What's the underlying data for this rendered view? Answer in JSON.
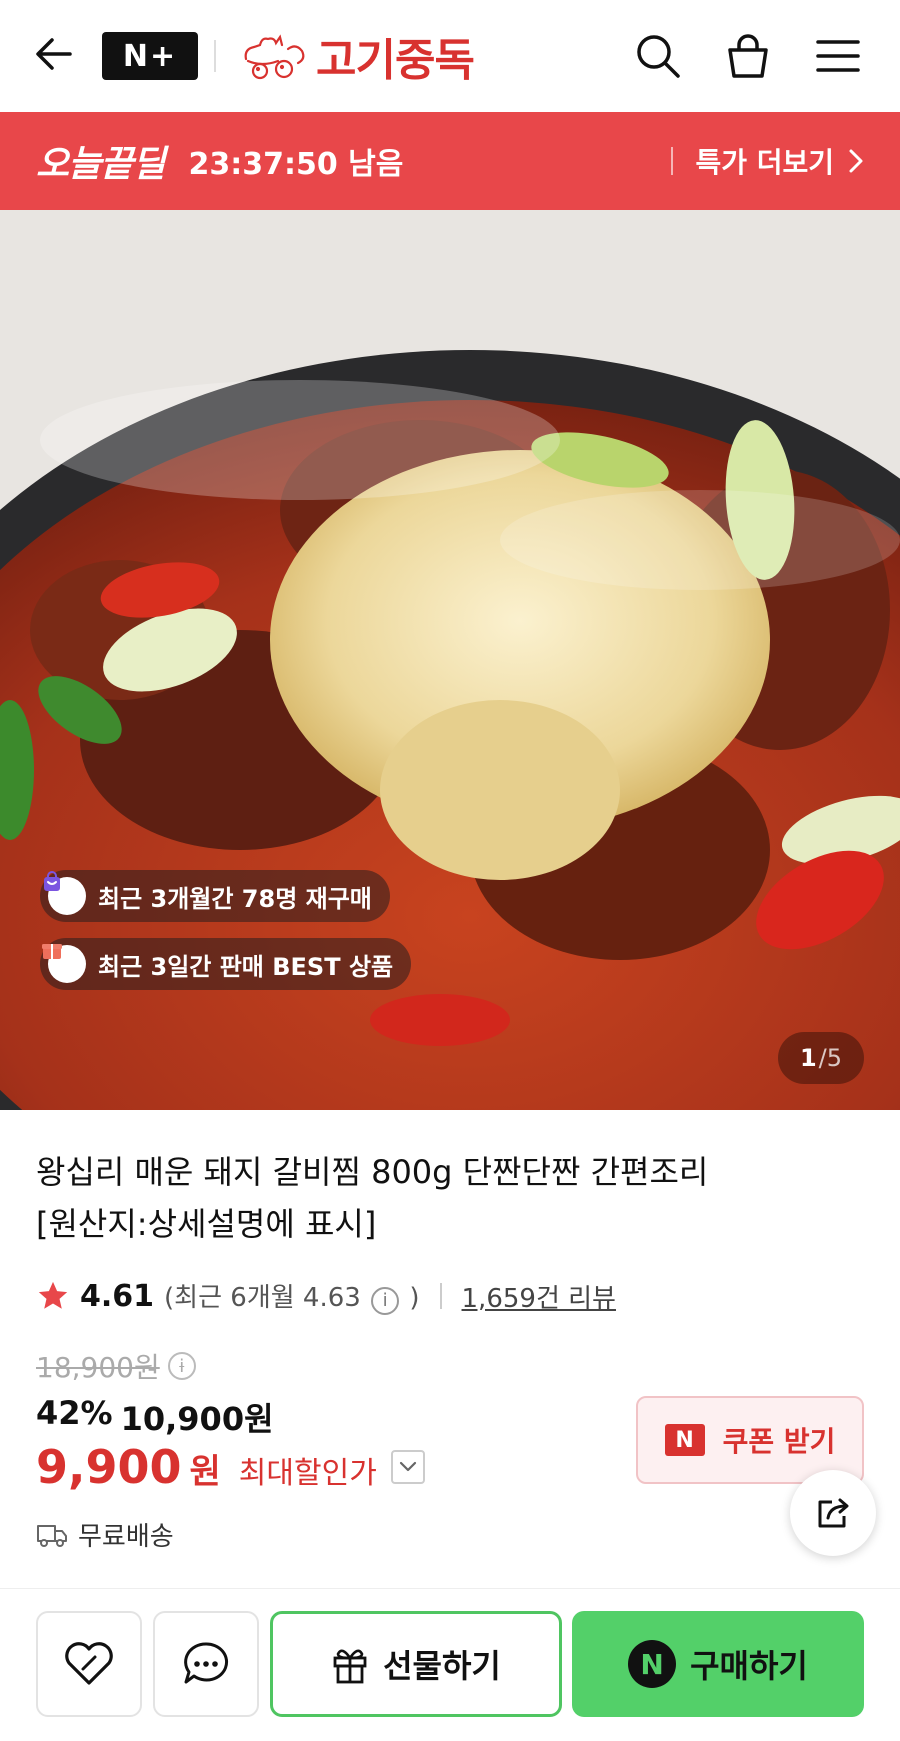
{
  "header": {
    "nplus_label": "N+",
    "brand_name": "고기중독",
    "icons": [
      "back-arrow-icon",
      "search-icon",
      "shopping-bag-icon",
      "menu-icon"
    ]
  },
  "deal": {
    "title": "오늘끝딜",
    "time_remaining": "23:37:50 남음",
    "more_label": "특가 더보기"
  },
  "gallery": {
    "badges": [
      {
        "icon": "repurchase-bag-icon",
        "text": "최근 3개월간 78명 재구매"
      },
      {
        "icon": "gift-best-icon",
        "text": "최근 3일간 판매 BEST 상품"
      }
    ],
    "current": "1",
    "total": "/5"
  },
  "product": {
    "title_line1": "왕십리 매운 돼지 갈비찜 800g 단짠단짠 간편조리",
    "title_line2": "[원산지:상세설명에 표시]",
    "rating": "4.61",
    "recent_rating_prefix": "(최근 6개월 4.63",
    "recent_rating_suffix": ")",
    "review_count": "1,659건 리뷰",
    "original_price": "18,900원",
    "discount_rate": "42%",
    "discount_price": "10,900원",
    "final_price_num": "9,900",
    "final_price_unit": "원",
    "max_discount_label": "최대할인가",
    "coupon_label": "쿠폰 받기",
    "shipping": "무료배송"
  },
  "bottom_bar": {
    "gift_label": "선물하기",
    "buy_label": "구매하기"
  },
  "colors": {
    "brand_red": "#d8322f",
    "deal_bar": "#e8474a",
    "buy_green": "#53d069"
  }
}
